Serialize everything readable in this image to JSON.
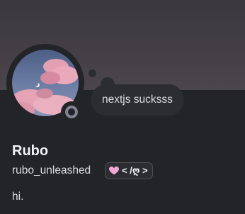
{
  "profile": {
    "display_name": "Rubo",
    "username": "rubo_unleashed",
    "custom_status": "nextjs sucksss",
    "bio": "hi.",
    "status": "offline",
    "badge": {
      "icon": "pink-heart-icon",
      "text": "< /ღ >"
    }
  },
  "colors": {
    "background": "#232428",
    "banner": "#433f45",
    "bubble": "#2b2d31",
    "status_offline": "#80848e",
    "heart": "#f2a7d8"
  }
}
